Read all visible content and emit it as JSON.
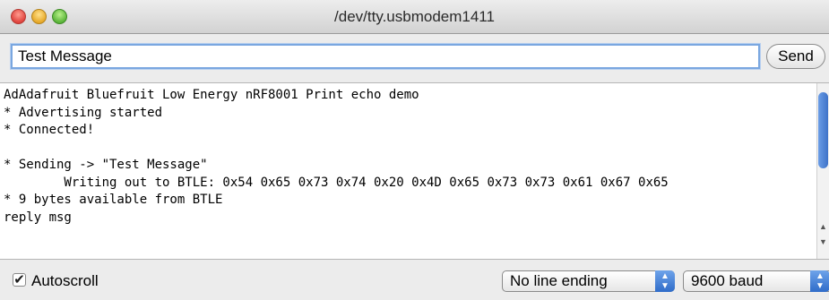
{
  "window": {
    "title": "/dev/tty.usbmodem1411"
  },
  "input": {
    "value": "Test Message",
    "send_label": "Send"
  },
  "console": {
    "lines": [
      "AdAdafruit Bluefruit Low Energy nRF8001 Print echo demo",
      "* Advertising started",
      "* Connected!",
      "",
      "* Sending -> \"Test Message\"",
      "        Writing out to BTLE: 0x54 0x65 0x73 0x74 0x20 0x4D 0x65 0x73 0x73 0x61 0x67 0x65",
      "* 9 bytes available from BTLE",
      "reply msg"
    ]
  },
  "footer": {
    "autoscroll_label": "Autoscroll",
    "autoscroll_checked": true,
    "line_ending": "No line ending",
    "baud": "9600 baud"
  },
  "icons": {
    "check": "checkmark-icon",
    "stepper": "up-down-arrows-icon"
  },
  "colors": {
    "accent": "#3d72c8",
    "focus": "#7aa7e0"
  }
}
